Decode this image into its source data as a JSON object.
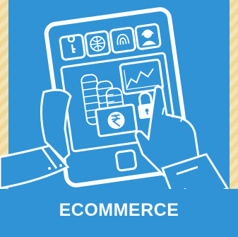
{
  "banner": {
    "title": "ECOMMERCE"
  },
  "colors": {
    "background_stripes": "#f3dca0",
    "panel_blue": "#2f93d6",
    "ink_white": "#ffffff"
  },
  "icons": [
    "key-icon",
    "globe-icon",
    "fingerprint-icon",
    "support-agent-icon",
    "coins-stack-icon",
    "rupee-note-icon",
    "padlock-icon",
    "chart-screen-icon"
  ]
}
